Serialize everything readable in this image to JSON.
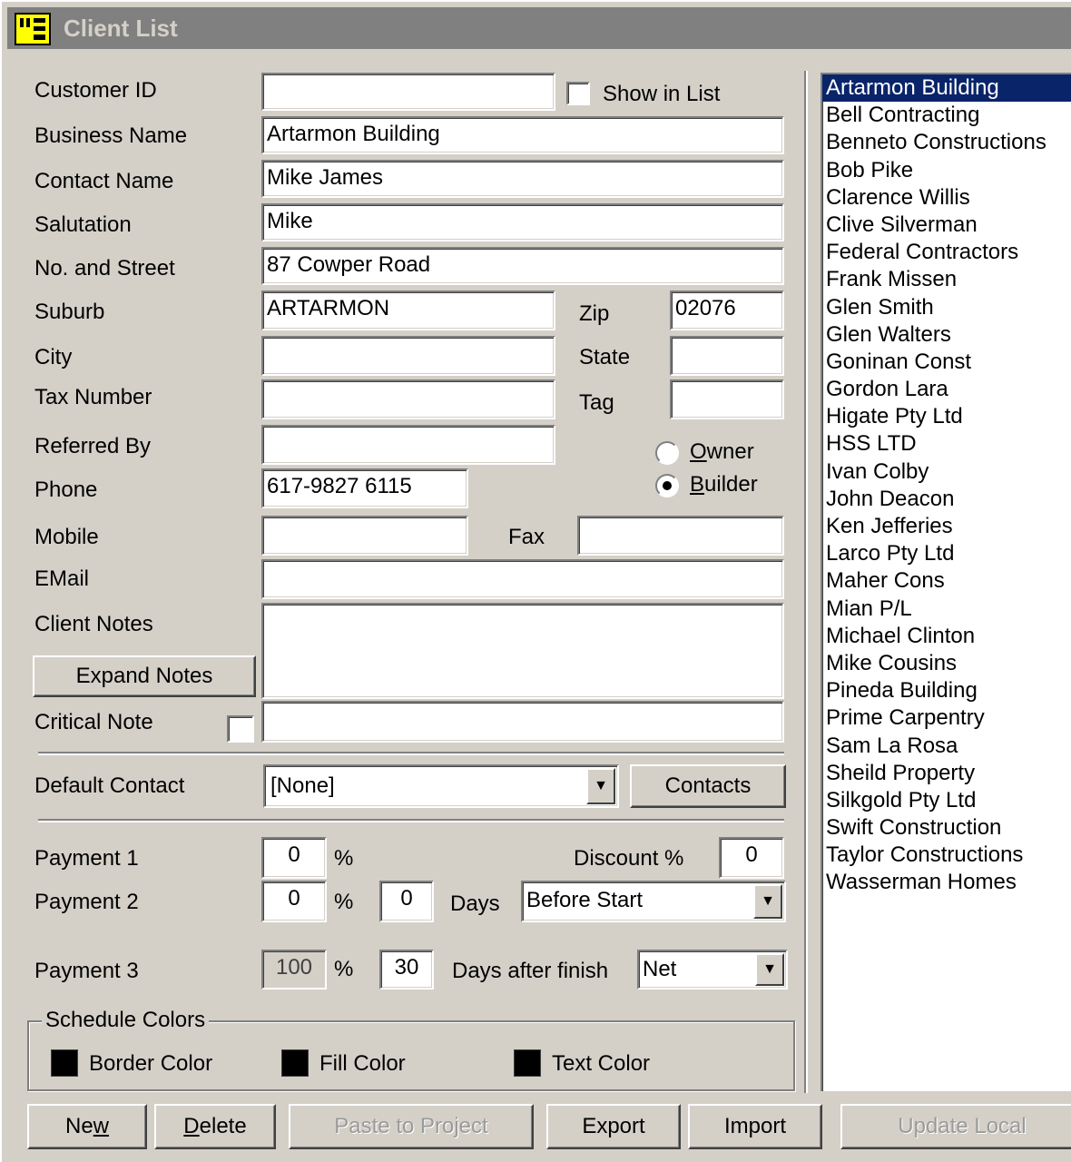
{
  "window": {
    "title": "Client List",
    "icon": "app-logo-icon"
  },
  "form": {
    "customer_id": {
      "label": "Customer ID",
      "value": ""
    },
    "show_in_list": {
      "label": "Show in List",
      "checked": false
    },
    "business_name": {
      "label": "Business Name",
      "value": "Artarmon Building"
    },
    "contact_name": {
      "label": "Contact Name",
      "value": "Mike James"
    },
    "salutation": {
      "label": "Salutation",
      "value": "Mike"
    },
    "street": {
      "label": "No. and Street",
      "value": "87 Cowper Road"
    },
    "suburb": {
      "label": "Suburb",
      "value": "ARTARMON"
    },
    "zip": {
      "label": "Zip",
      "value": "02076"
    },
    "city": {
      "label": "City",
      "value": ""
    },
    "state": {
      "label": "State",
      "value": ""
    },
    "tax_number": {
      "label": "Tax Number",
      "value": ""
    },
    "tag": {
      "label": "Tag",
      "value": ""
    },
    "referred_by": {
      "label": "Referred By",
      "value": ""
    },
    "client_type": {
      "options": [
        {
          "label": "Owner",
          "mnemonic": "O",
          "rest": "wner",
          "checked": false
        },
        {
          "label": "Builder",
          "mnemonic": "B",
          "rest": "uilder",
          "checked": true
        }
      ]
    },
    "phone": {
      "label": "Phone",
      "value": "617-9827 6115"
    },
    "mobile": {
      "label": "Mobile",
      "value": ""
    },
    "fax": {
      "label": "Fax",
      "value": ""
    },
    "email": {
      "label": "EMail",
      "value": ""
    },
    "client_notes": {
      "label": "Client Notes",
      "value": ""
    },
    "expand_notes_button": "Expand Notes",
    "critical_note": {
      "label": "Critical Note",
      "checked": false,
      "value": ""
    },
    "default_contact": {
      "label": "Default Contact",
      "selected": "[None]"
    },
    "contacts_button": "Contacts"
  },
  "payments": {
    "payment1": {
      "label": "Payment 1",
      "percent": "0",
      "percent_sign": "%"
    },
    "discount": {
      "label": "Discount %",
      "value": "0"
    },
    "payment2": {
      "label": "Payment 2",
      "percent": "0",
      "percent_sign": "%",
      "days": "0",
      "days_label": "Days",
      "timing": "Before Start"
    },
    "payment3": {
      "label": "Payment 3",
      "percent": "100",
      "percent_sign": "%",
      "days": "30",
      "days_label": "Days after finish",
      "terms": "Net"
    }
  },
  "schedule_colors": {
    "title": "Schedule Colors",
    "items": [
      {
        "label": "Border Color",
        "color": "#000000"
      },
      {
        "label": "Fill Color",
        "color": "#000000"
      },
      {
        "label": "Text Color",
        "color": "#000000"
      }
    ]
  },
  "buttons": {
    "new": {
      "pre": "Ne",
      "mnemonic": "w",
      "post": ""
    },
    "delete": {
      "pre": "",
      "mnemonic": "D",
      "post": "elete"
    },
    "paste_to_project": "Paste to Project",
    "export": "Export",
    "import": "Import",
    "update_local": "Update Local"
  },
  "client_list": {
    "selected_index": 0,
    "items": [
      "Artarmon Building",
      "Bell Contracting",
      "Benneto Constructions",
      "Bob Pike",
      "Clarence Willis",
      "Clive Silverman",
      "Federal Contractors",
      "Frank Missen",
      "Glen Smith",
      "Glen Walters",
      "Goninan Const",
      "Gordon Lara",
      "Higate Pty Ltd",
      "HSS LTD",
      "Ivan Colby",
      "John Deacon",
      "Ken Jefferies",
      "Larco Pty Ltd",
      "Maher Cons",
      "Mian P/L",
      "Michael Clinton",
      "Mike Cousins",
      "Pineda Building",
      "Prime Carpentry",
      "Sam La Rosa",
      "Sheild Property",
      "Silkgold Pty Ltd",
      "Swift Construction",
      "Taylor Constructions",
      "Wasserman Homes"
    ]
  },
  "colors": {
    "selection": "#0a246a",
    "face": "#d4d0c8",
    "title_bg": "#808080",
    "logo": "#ffff00"
  }
}
